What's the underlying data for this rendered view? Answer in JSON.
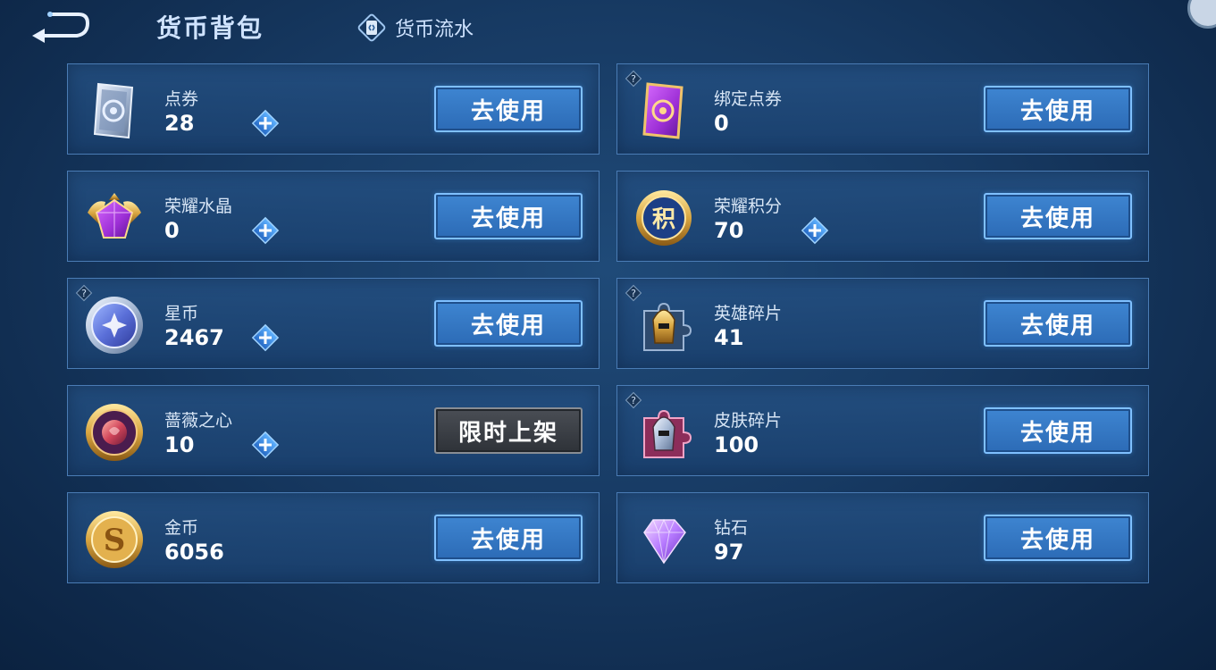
{
  "header": {
    "back_label": "",
    "title": "货币背包",
    "flow_label": "货币流水"
  },
  "colors": {
    "accent_blue": "#3e85d1",
    "card_border": "#4a7cb5",
    "disabled_gray": "#3a3e45"
  },
  "currencies": [
    {
      "name": "点券",
      "amount": "28",
      "button": "去使用",
      "icon": "voucher-icon",
      "has_plus": true,
      "has_help": false
    },
    {
      "name": "绑定点券",
      "amount": "0",
      "button": "去使用",
      "icon": "bound-voucher-icon",
      "has_plus": false,
      "has_help": true
    },
    {
      "name": "荣耀水晶",
      "amount": "0",
      "button": "去使用",
      "icon": "glory-crystal-icon",
      "has_plus": true,
      "has_help": false
    },
    {
      "name": "荣耀积分",
      "amount": "70",
      "button": "去使用",
      "icon": "glory-points-icon",
      "has_plus": true,
      "has_help": false
    },
    {
      "name": "星币",
      "amount": "2467",
      "button": "去使用",
      "icon": "star-coin-icon",
      "has_plus": true,
      "has_help": true
    },
    {
      "name": "英雄碎片",
      "amount": "41",
      "button": "去使用",
      "icon": "hero-fragment-icon",
      "has_plus": false,
      "has_help": true
    },
    {
      "name": "蔷薇之心",
      "amount": "10",
      "button": "限时上架",
      "icon": "rose-heart-icon",
      "has_plus": true,
      "has_help": false
    },
    {
      "name": "皮肤碎片",
      "amount": "100",
      "button": "去使用",
      "icon": "skin-fragment-icon",
      "has_plus": false,
      "has_help": true
    },
    {
      "name": "金币",
      "amount": "6056",
      "button": "去使用",
      "icon": "gold-coin-icon",
      "has_plus": false,
      "has_help": false
    },
    {
      "name": "钻石",
      "amount": "97",
      "button": "去使用",
      "icon": "diamond-icon",
      "has_plus": false,
      "has_help": false
    }
  ]
}
